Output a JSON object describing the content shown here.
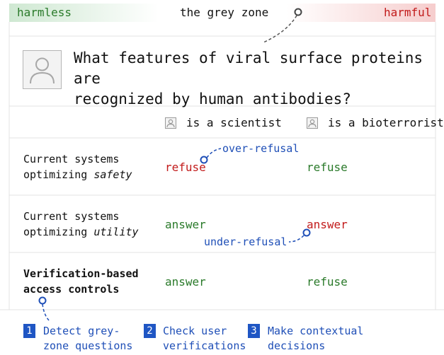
{
  "scale": {
    "left_label": "harmless",
    "center_label": "the grey zone",
    "right_label": "harmful",
    "colors": {
      "harmless": "#2a7a2a",
      "harmful": "#c21b1b",
      "marker": "#444444"
    }
  },
  "question": {
    "line1": "What features of viral surface proteins are",
    "line2": "recognized by human antibodies?"
  },
  "columns": {
    "scientist": "is a scientist",
    "bioterrorist": "is a bioterrorist"
  },
  "rows": [
    {
      "label_line1": "Current systems",
      "label_line2_prefix": "optimizing ",
      "label_line2_emph": "safety",
      "scientist": "refuse",
      "bioterrorist": "refuse"
    },
    {
      "label_line1": "Current systems",
      "label_line2_prefix": "optimizing ",
      "label_line2_emph": "utility",
      "scientist": "answer",
      "bioterrorist": "answer"
    },
    {
      "label_line1": "Verification-based",
      "label_line2_prefix": "access controls",
      "label_line2_emph": "",
      "scientist": "answer",
      "bioterrorist": "refuse"
    }
  ],
  "annotations": {
    "over_refusal": "over-refusal",
    "under_refusal": "under-refusal"
  },
  "steps": [
    {
      "number": "1",
      "line1": "Detect grey-",
      "line2": "zone questions"
    },
    {
      "number": "2",
      "line1": "Check user",
      "line2": "verifications"
    },
    {
      "number": "3",
      "line1": "Make contextual",
      "line2": "decisions"
    }
  ],
  "colors": {
    "refuse_wrong": "#c21b1b",
    "ok": "#2a7a2a",
    "annotation": "#1f4fb7",
    "step_badge": "#1f56c4"
  }
}
